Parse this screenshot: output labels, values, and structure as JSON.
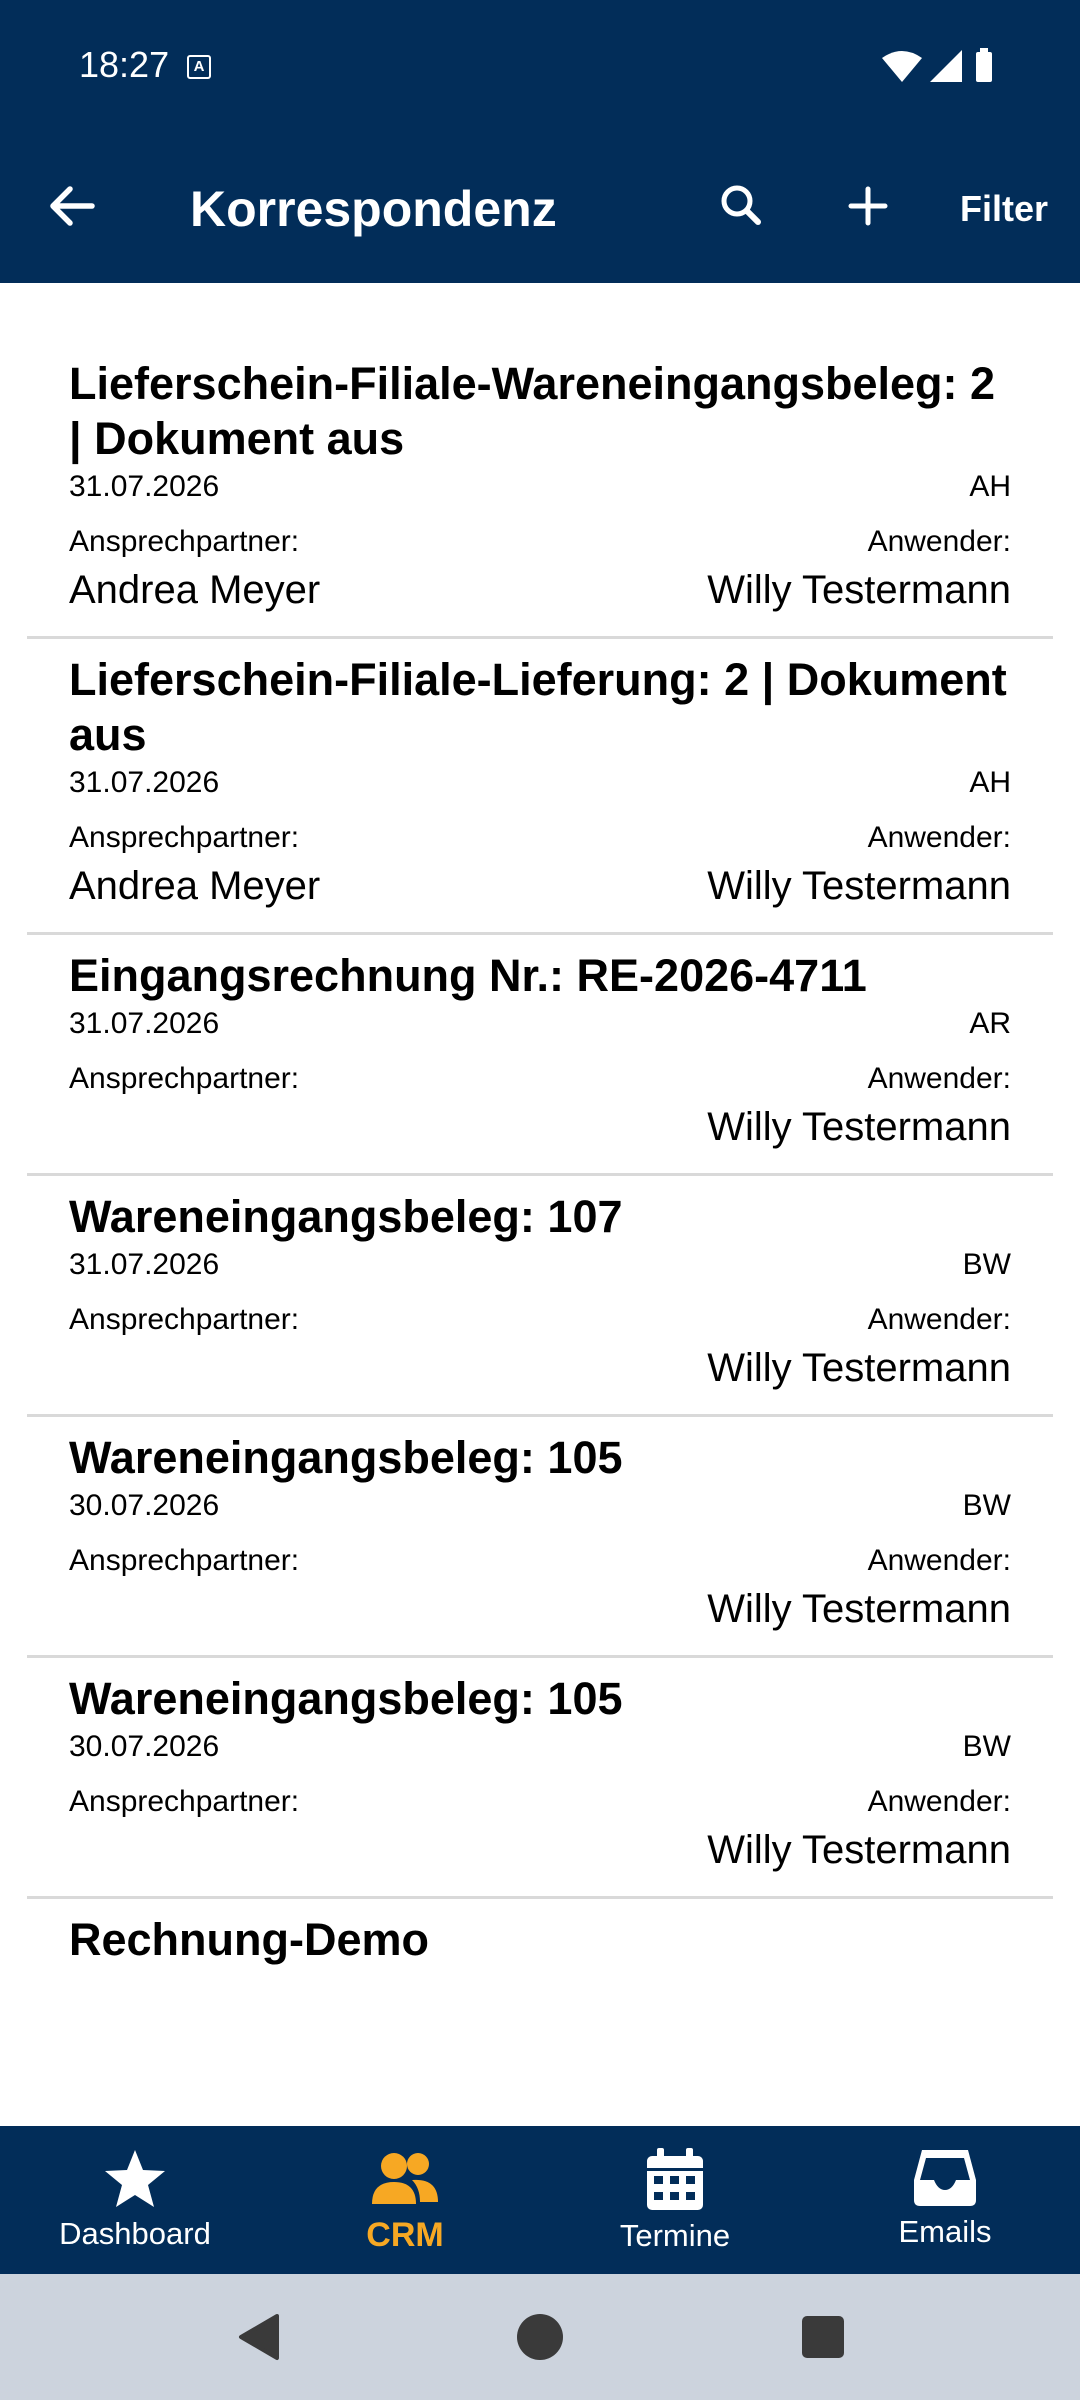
{
  "status_bar": {
    "time": "18:27"
  },
  "app_bar": {
    "title": "Korrespondenz",
    "filter_label": "Filter",
    "icons": [
      "back-arrow-icon",
      "search-icon",
      "plus-icon"
    ]
  },
  "list": {
    "items": [
      {
        "title": "Lieferschein-Filiale-Wareneingangsbeleg: 2 | Dokument aus",
        "date": "31.07.2026",
        "code": "AH",
        "contact_label": "Ansprechpartner:",
        "user_label": "Anwender:",
        "contact": "Andrea Meyer",
        "user": "Willy Testermann"
      },
      {
        "title": "Lieferschein-Filiale-Lieferung: 2 | Dokument aus",
        "date": "31.07.2026",
        "code": "AH",
        "contact_label": "Ansprechpartner:",
        "user_label": "Anwender:",
        "contact": "Andrea Meyer",
        "user": "Willy Testermann"
      },
      {
        "title": "Eingangsrechnung Nr.: RE-2026-4711",
        "date": "31.07.2026",
        "code": "AR",
        "contact_label": "Ansprechpartner:",
        "user_label": "Anwender:",
        "contact": "",
        "user": "Willy Testermann"
      },
      {
        "title": "Wareneingangsbeleg: 107",
        "date": "31.07.2026",
        "code": "BW",
        "contact_label": "Ansprechpartner:",
        "user_label": "Anwender:",
        "contact": "",
        "user": "Willy Testermann"
      },
      {
        "title": "Wareneingangsbeleg: 105",
        "date": "30.07.2026",
        "code": "BW",
        "contact_label": "Ansprechpartner:",
        "user_label": "Anwender:",
        "contact": "",
        "user": "Willy Testermann"
      },
      {
        "title": "Wareneingangsbeleg: 105",
        "date": "30.07.2026",
        "code": "BW",
        "contact_label": "Ansprechpartner:",
        "user_label": "Anwender:",
        "contact": "",
        "user": "Willy Testermann"
      },
      {
        "title": "Rechnung-Demo",
        "date": "",
        "code": "",
        "contact_label": "",
        "user_label": "",
        "contact": "",
        "user": ""
      }
    ]
  },
  "bottom_nav": {
    "active_color": "#f7a823",
    "items": [
      {
        "label": "Dashboard",
        "icon": "star-icon",
        "active": false
      },
      {
        "label": "CRM",
        "icon": "people-icon",
        "active": true
      },
      {
        "label": "Termine",
        "icon": "calendar-icon",
        "active": false
      },
      {
        "label": "Emails",
        "icon": "inbox-icon",
        "active": false
      }
    ]
  },
  "colors": {
    "header": "#022d59",
    "accent": "#f7a823",
    "system_nav": "#ccd3dd"
  }
}
